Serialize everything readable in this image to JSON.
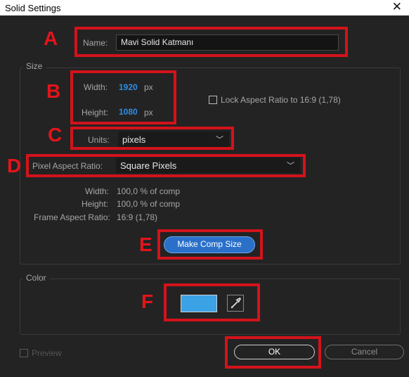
{
  "window": {
    "title": "Solid Settings",
    "close_glyph": "✕"
  },
  "name": {
    "label": "Name:",
    "value": "Mavi Solid Katmanı"
  },
  "size_group": {
    "title": "Size",
    "width_label": "Width:",
    "width_value": "1920",
    "width_unit": "px",
    "height_label": "Height:",
    "height_value": "1080",
    "height_unit": "px",
    "lock_aspect": {
      "label": "Lock Aspect Ratio to 16:9 (1,78)",
      "checked": false
    },
    "units": {
      "label": "Units:",
      "value": "pixels"
    },
    "pixel_aspect": {
      "label": "Pixel Aspect Ratio:",
      "value": "Square Pixels"
    },
    "info": {
      "width_label": "Width:",
      "width_value": "100,0 % of comp",
      "height_label": "Height:",
      "height_value": "100,0 % of comp",
      "frame_label": "Frame Aspect Ratio:",
      "frame_value": "16:9 (1,78)"
    },
    "make_comp_size": "Make Comp Size"
  },
  "color_group": {
    "title": "Color",
    "swatch_color": "#3ba2e6",
    "eyedropper_icon": "eyedropper-icon"
  },
  "preview": {
    "label": "Preview",
    "checked": false
  },
  "buttons": {
    "ok": "OK",
    "cancel": "Cancel"
  },
  "annotations": {
    "a": "A",
    "b": "B",
    "c": "C",
    "d": "D",
    "e": "E",
    "f": "F",
    "color": "#d3131b"
  }
}
